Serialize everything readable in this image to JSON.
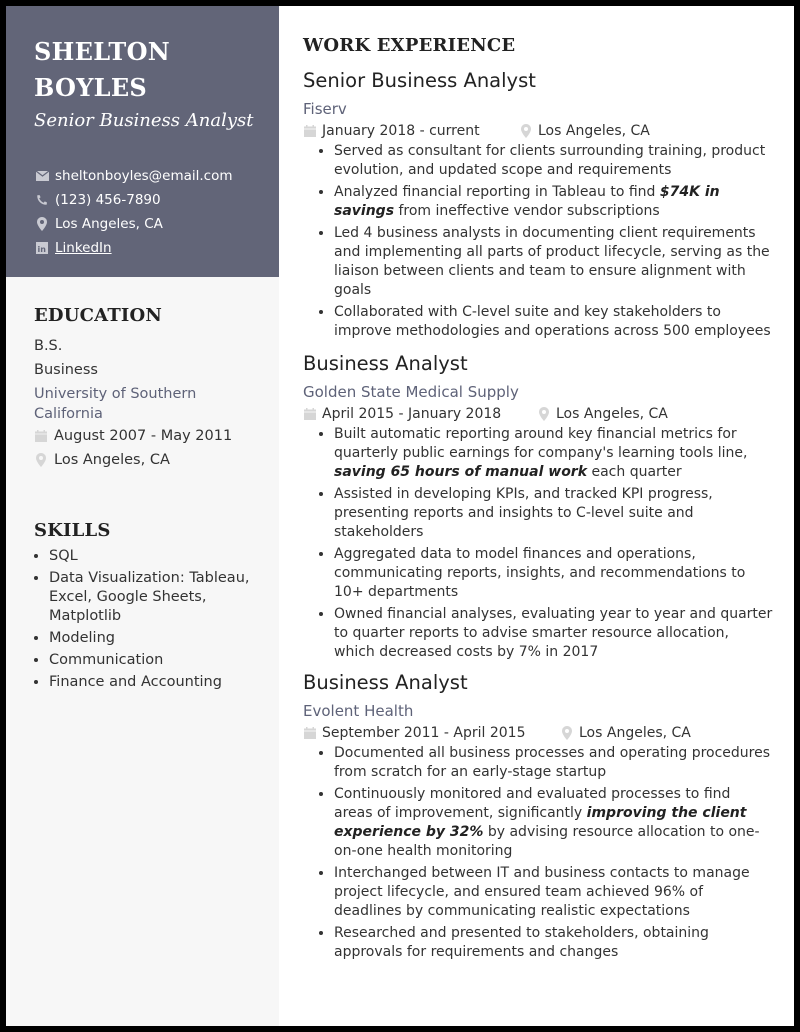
{
  "profile": {
    "name_line1": "SHELTON",
    "name_line2": "BOYLES",
    "title": "Senior Business Analyst",
    "contacts": {
      "email": "sheltonboyles@email.com",
      "phone": "(123) 456-7890",
      "location": "Los Angeles, CA",
      "linkedin": "LinkedIn"
    }
  },
  "colors": {
    "accent": "#626578",
    "sidebar_bg": "#f7f7f7",
    "company": "#5e6278"
  },
  "education": {
    "heading": "EDUCATION",
    "degree": "B.S.",
    "field": "Business",
    "school": "University of Southern California",
    "dates": "August 2007 - May 2011",
    "location": "Los Angeles, CA"
  },
  "skills": {
    "heading": "SKILLS",
    "items": [
      "SQL",
      "Data Visualization: Tableau, Excel, Google Sheets, Matplotlib",
      "Modeling",
      "Communication",
      "Finance and Accounting"
    ]
  },
  "work": {
    "heading": "WORK EXPERIENCE",
    "jobs": [
      {
        "title": "Senior Business Analyst",
        "company": "Fiserv",
        "dates": "January 2018 - current",
        "location": "Los Angeles, CA",
        "bullets": [
          {
            "pre": "Served as consultant for clients surrounding training, product evolution, and updated scope and requirements",
            "em": "",
            "post": ""
          },
          {
            "pre": "Analyzed financial reporting in Tableau to find ",
            "em": "$74K in savings",
            "post": " from ineffective vendor subscriptions"
          },
          {
            "pre": "Led 4 business analysts in documenting client requirements and implementing all parts of product lifecycle, serving as the liaison between clients and team to ensure alignment with goals",
            "em": "",
            "post": ""
          },
          {
            "pre": "Collaborated with C-level suite and key stakeholders to improve methodologies and operations across 500 employees",
            "em": "",
            "post": ""
          }
        ]
      },
      {
        "title": "Business Analyst",
        "company": "Golden State Medical Supply",
        "dates": "April 2015 - January 2018",
        "location": "Los Angeles, CA",
        "bullets": [
          {
            "pre": "Built automatic reporting around key financial metrics for quarterly public earnings for company's learning tools line, ",
            "em": "saving 65 hours of manual work",
            "post": " each quarter"
          },
          {
            "pre": "Assisted in developing KPIs, and tracked KPI progress, presenting reports and insights to C-level suite and stakeholders",
            "em": "",
            "post": ""
          },
          {
            "pre": "Aggregated data to model finances and operations, communicating reports, insights, and recommendations to 10+ departments",
            "em": "",
            "post": ""
          },
          {
            "pre": "Owned financial analyses, evaluating year to year and quarter to quarter reports to advise smarter resource allocation, which decreased costs by 7% in 2017",
            "em": "",
            "post": ""
          }
        ]
      },
      {
        "title": "Business Analyst",
        "company": "Evolent Health",
        "dates": "September 2011 - April 2015",
        "location": "Los Angeles, CA",
        "bullets": [
          {
            "pre": "Documented all business processes and operating procedures from scratch for an early-stage startup",
            "em": "",
            "post": ""
          },
          {
            "pre": "Continuously monitored and evaluated processes to find areas of improvement, significantly ",
            "em": "improving the client experience by 32%",
            "post": " by advising resource allocation to one-on-one health monitoring"
          },
          {
            "pre": "Interchanged between IT and business contacts to manage project lifecycle, and ensured team achieved 96% of deadlines by communicating realistic expectations",
            "em": "",
            "post": ""
          },
          {
            "pre": "Researched and presented to stakeholders, obtaining approvals for requirements and changes",
            "em": "",
            "post": ""
          }
        ]
      }
    ]
  }
}
